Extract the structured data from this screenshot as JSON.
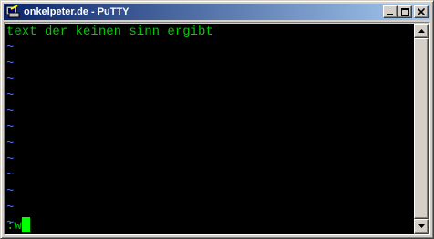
{
  "window": {
    "title": "onkelpeter.de - PuTTY",
    "icons": {
      "app": "putty-terminal-icon",
      "minimize": "minimize-icon",
      "maximize": "maximize-icon",
      "close": "close-icon"
    }
  },
  "terminal": {
    "lines": [
      "text der keinen sinn ergibt",
      "~",
      "~",
      "~",
      "~",
      "~",
      "~",
      "~",
      "~",
      "~",
      "~",
      "~",
      "~"
    ],
    "command_line": ":w",
    "colors": {
      "background": "#000000",
      "text": "#00cc00",
      "tilde": "#4a6cff",
      "cursor": "#00ff00"
    }
  }
}
